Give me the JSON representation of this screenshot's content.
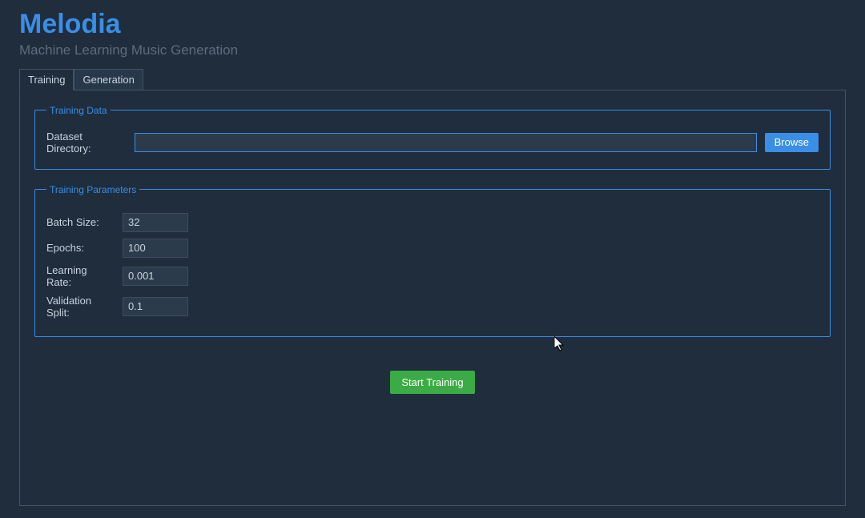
{
  "header": {
    "title": "Melodia",
    "subtitle": "Machine Learning Music Generation"
  },
  "tabs": {
    "training_label": "Training",
    "generation_label": "Generation",
    "active": "training"
  },
  "training_data_group": {
    "legend": "Training Data",
    "dataset_label": "Dataset Directory:",
    "dataset_value": "",
    "browse_label": "Browse"
  },
  "training_params_group": {
    "legend": "Training Parameters",
    "batch_size_label": "Batch Size:",
    "batch_size_value": "32",
    "epochs_label": "Epochs:",
    "epochs_value": "100",
    "learning_rate_label": "Learning Rate:",
    "learning_rate_value": "0.001",
    "validation_split_label": "Validation Split:",
    "validation_split_value": "0.1"
  },
  "actions": {
    "start_training_label": "Start Training"
  },
  "colors": {
    "bg": "#1f2d3d",
    "accent": "#3a8ee6",
    "start_btn": "#3bab46"
  }
}
